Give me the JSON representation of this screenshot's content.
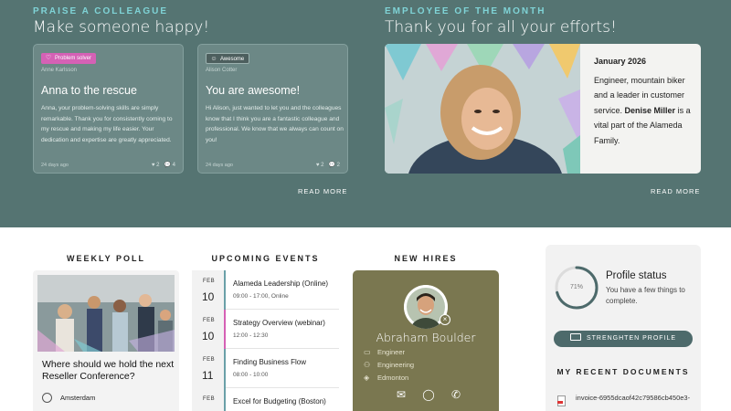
{
  "praise": {
    "eyebrow": "PRAISE A COLLEAGUE",
    "title": "Make someone happy!",
    "cards": [
      {
        "badge": "Problem solver",
        "badge_icon": "heart-icon",
        "author": "Anne Karlsson",
        "title": "Anna to the rescue",
        "body": "Anna, your problem-solving skills are simply remarkable. Thank you for consistently coming to my rescue and making my life easier. Your dedication and expertise are greatly appreciated.",
        "date": "24 days ago",
        "likes": "2",
        "comments": "4"
      },
      {
        "badge": "Awesome",
        "badge_icon": "smile-icon",
        "author": "Alison Cotter",
        "title": "You are awesome!",
        "body": "Hi Alison, just wanted to let you and the colleagues know that I think you are a fantastic colleague and professional. We know that we always can count on you!",
        "date": "24 days ago",
        "likes": "2",
        "comments": "2"
      }
    ],
    "read_more": "READ MORE"
  },
  "eom": {
    "eyebrow": "EMPLOYEE OF THE MONTH",
    "title": "Thank you for all your efforts!",
    "date": "January 2026",
    "text_before": "Engineer, mountain biker and a leader in customer service.",
    "name": "Denise Miller",
    "text_after": "is a vital part of the Alameda Family.",
    "read_more": "READ MORE"
  },
  "poll": {
    "heading": "WEEKLY POLL",
    "question": "Where should we hold the next Reseller Conference?",
    "option": "Amsterdam"
  },
  "events": {
    "heading": "UPCOMING EVENTS",
    "items": [
      {
        "month": "FEB",
        "day": "10",
        "title": "Alameda Leadership (Online)",
        "time": "09:00 - 17:00, Online"
      },
      {
        "month": "FEB",
        "day": "10",
        "title": "Strategy Overview (webinar)",
        "time": "12:00 - 12:30"
      },
      {
        "month": "FEB",
        "day": "11",
        "title": "Finding Business Flow",
        "time": "08:00 - 10:00"
      },
      {
        "month": "FEB",
        "day": "",
        "title": "Excel for Budgeting (Boston)",
        "time": ""
      }
    ]
  },
  "hires": {
    "heading": "NEW HIRES",
    "name": "Abraham Boulder",
    "role": "Engineer",
    "department": "Engineering",
    "location": "Edmonton"
  },
  "profile": {
    "percent": "71%",
    "progress": 0.71,
    "title": "Profile status",
    "subtitle": "You have a few things to complete.",
    "button": "STRENGHTEN PROFILE",
    "docs_heading": "MY RECENT DOCUMENTS",
    "doc_name": "invoice-6955dcaof42c79586cb450e3-"
  },
  "colors": {
    "band": "#557472",
    "accent_teal": "#7fd3d6",
    "badge_pink": "#d561b5",
    "hire_card": "#7a7750",
    "button": "#4d6a6b"
  }
}
